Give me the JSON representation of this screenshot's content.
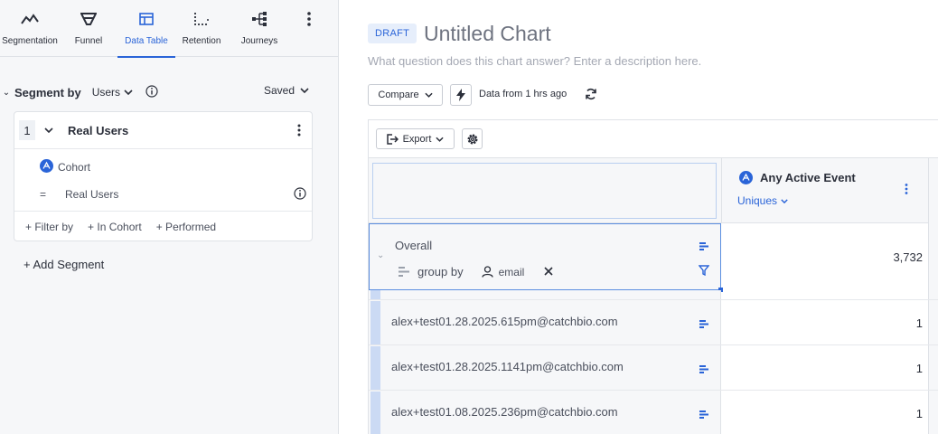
{
  "nav": {
    "tabs": [
      {
        "label": "Segmentation",
        "icon": "line-chart-icon"
      },
      {
        "label": "Funnel",
        "icon": "funnel-icon"
      },
      {
        "label": "Data Table",
        "icon": "table-icon",
        "active": true
      },
      {
        "label": "Retention",
        "icon": "retention-icon"
      },
      {
        "label": "Journeys",
        "icon": "journeys-icon"
      }
    ],
    "more_icon": "more-vertical-icon"
  },
  "segment_panel": {
    "title": "Segment by",
    "users_dropdown": "Users",
    "saved_dropdown": "Saved",
    "segment": {
      "number": "1",
      "name": "Real Users",
      "cohort_label": "Cohort",
      "operator": "=",
      "value": "Real Users",
      "footer": [
        "+ Filter by",
        "+ In Cohort",
        "+ Performed"
      ]
    },
    "add_segment": "+ Add Segment"
  },
  "chart": {
    "badge": "DRAFT",
    "title": "Untitled Chart",
    "description_placeholder": "What question does this chart answer? Enter a description here.",
    "compare_label": "Compare",
    "data_freshness": "Data from 1 hrs ago"
  },
  "table": {
    "export_label": "Export",
    "metric": {
      "name": "Any Active Event",
      "subtitle": "Uniques"
    },
    "overall": {
      "label": "Overall",
      "group_by_label": "group by",
      "group_by_property": "email",
      "value": "3,732"
    },
    "rows": [
      {
        "label": "alex+test01.28.2025.615pm@catchbio.com",
        "value": "1"
      },
      {
        "label": "alex+test01.28.2025.1141pm@catchbio.com",
        "value": "1"
      },
      {
        "label": "alex+test01.08.2025.236pm@catchbio.com",
        "value": "1"
      }
    ]
  },
  "colors": {
    "accent": "#2a64d8",
    "panel_bg": "#f6f7f9",
    "row_bar": "#cbdaf4"
  }
}
